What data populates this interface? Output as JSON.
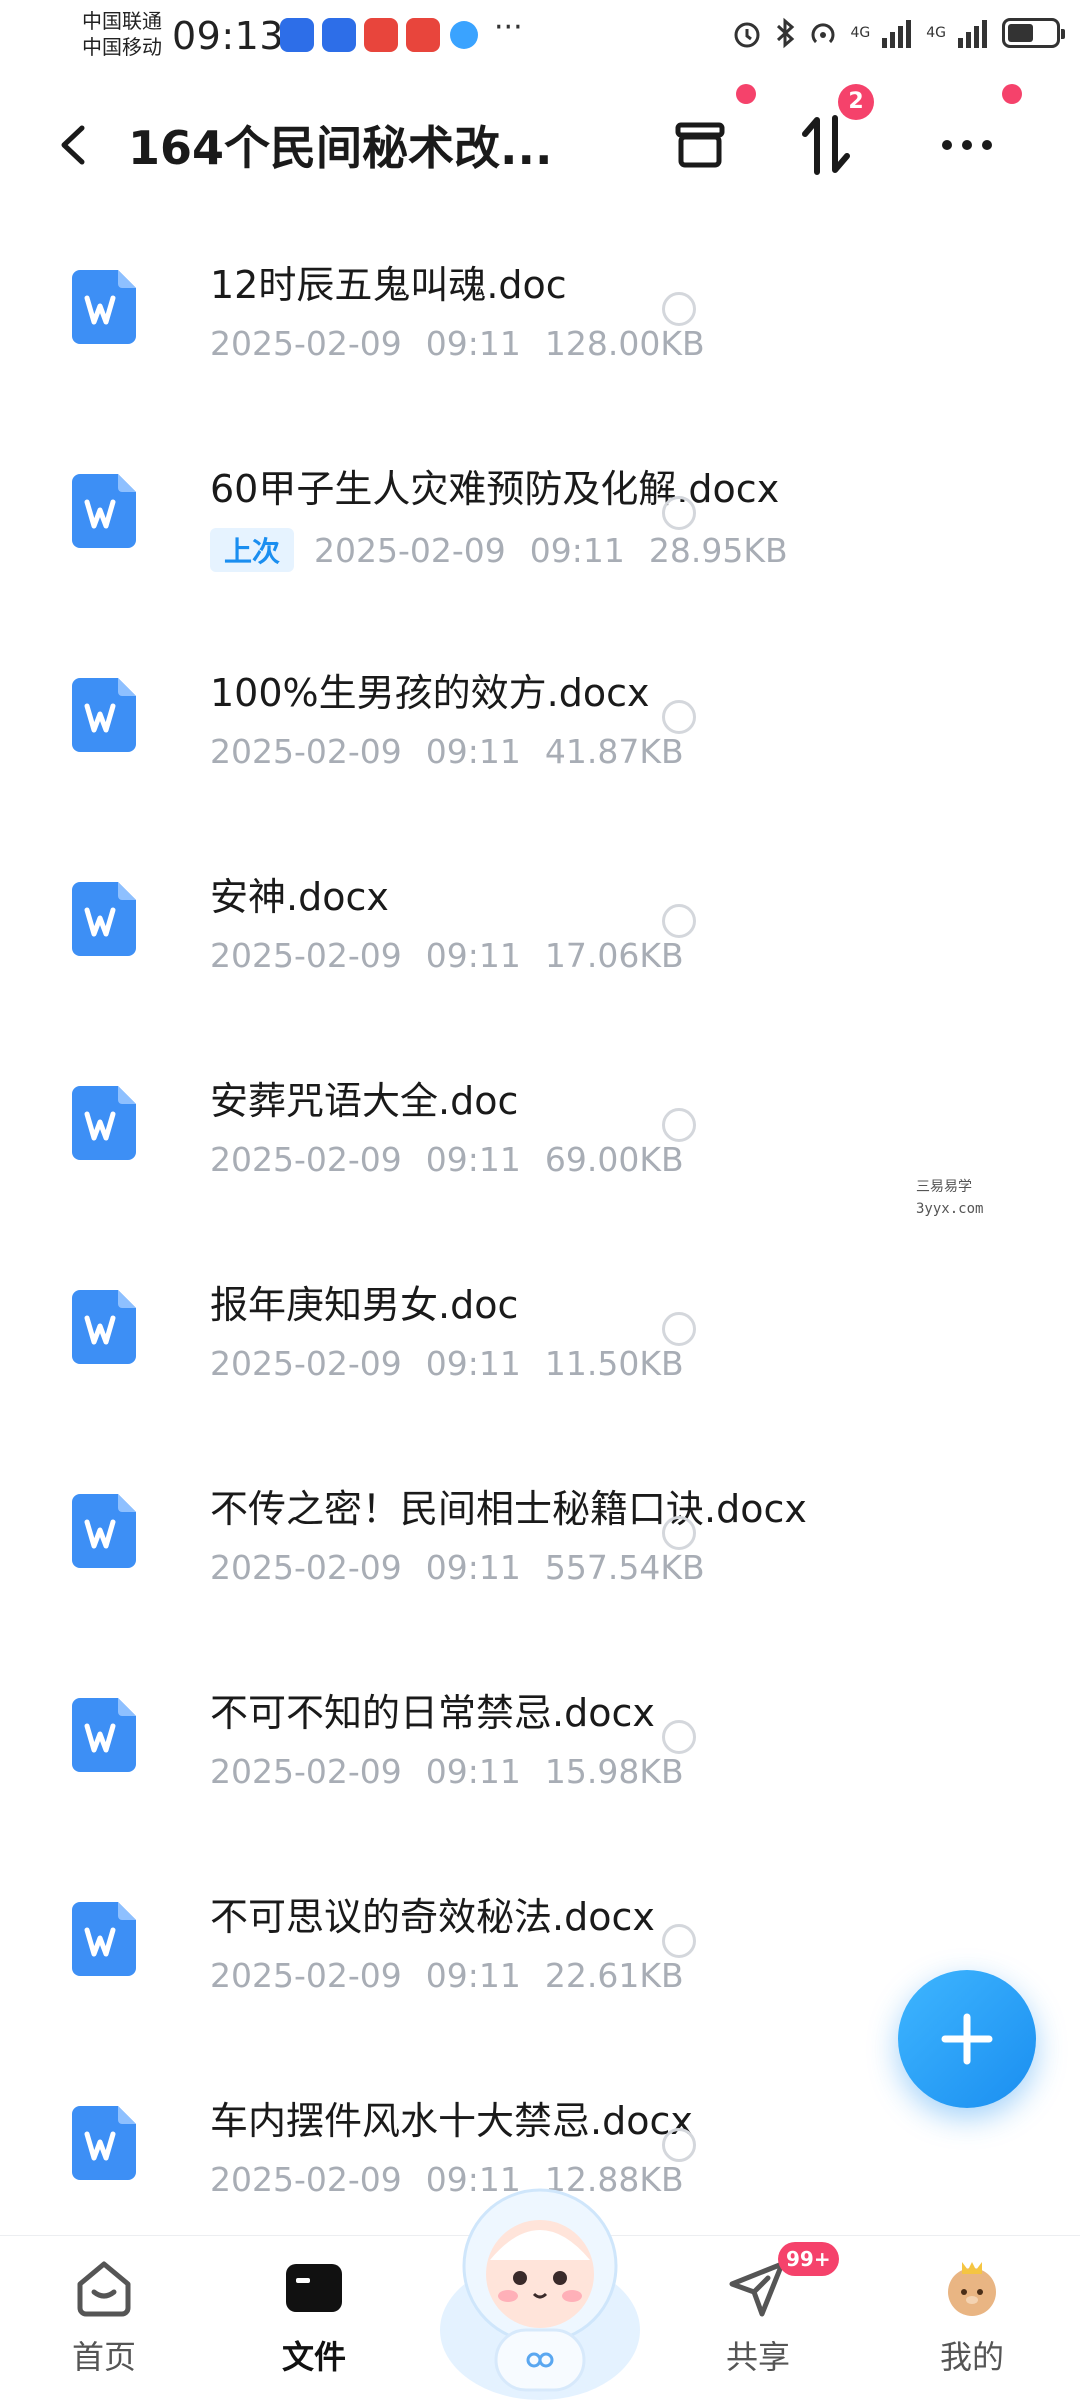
{
  "status_bar": {
    "carrier_1": "中国联通",
    "carrier_2": "中国移动",
    "time": "09:13",
    "dots": "···",
    "signal_1_label": "4G",
    "signal_2_label": "4G",
    "battery_level": 0.55
  },
  "header": {
    "title": "164个民间秘术改...",
    "sort_badge": "2"
  },
  "files": [
    {
      "name": "12时辰五鬼叫魂.doc",
      "date": "2025-02-09",
      "time": "09:11",
      "size": "128.00KB"
    },
    {
      "name": "60甲子生人灾难预防及化解.docx",
      "tag": "上次",
      "date": "2025-02-09",
      "time": "09:11",
      "size": "28.95KB"
    },
    {
      "name": "100%生男孩的效方.docx",
      "date": "2025-02-09",
      "time": "09:11",
      "size": "41.87KB"
    },
    {
      "name": "安神.docx",
      "date": "2025-02-09",
      "time": "09:11",
      "size": "17.06KB"
    },
    {
      "name": "安葬咒语大全.doc",
      "date": "2025-02-09",
      "time": "09:11",
      "size": "69.00KB"
    },
    {
      "name": "报年庚知男女.doc",
      "date": "2025-02-09",
      "time": "09:11",
      "size": "11.50KB"
    },
    {
      "name": "不传之密！民间相士秘籍口诀.docx",
      "date": "2025-02-09",
      "time": "09:11",
      "size": "557.54KB"
    },
    {
      "name": "不可不知的日常禁忌.docx",
      "date": "2025-02-09",
      "time": "09:11",
      "size": "15.98KB"
    },
    {
      "name": "不可思议的奇效秘法.docx",
      "date": "2025-02-09",
      "time": "09:11",
      "size": "22.61KB"
    },
    {
      "name": "车内摆件风水十大禁忌.docx",
      "date": "2025-02-09",
      "time": "09:11",
      "size": "12.88KB"
    }
  ],
  "watermark": {
    "line1": "三易易学",
    "line2": "3yyx.com"
  },
  "bottom_nav": {
    "home": "首页",
    "files": "文件",
    "share": "共享",
    "share_badge": "99+",
    "mine": "我的"
  },
  "colors": {
    "accent": "#1a8ef0",
    "badge": "#f5426b",
    "file_icon": "#3d8ff5",
    "meta_text": "#a8adb5"
  }
}
